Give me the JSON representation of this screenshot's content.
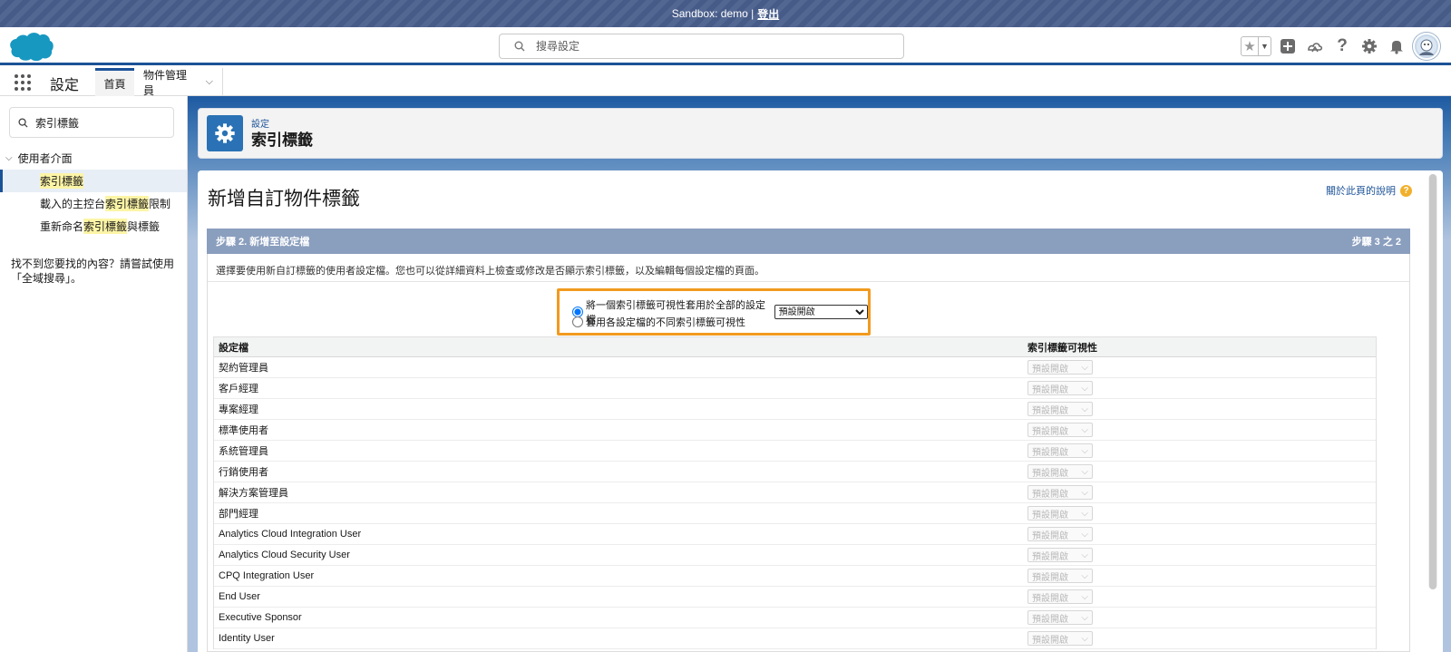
{
  "banner": {
    "text": "Sandbox: demo |",
    "logout": "登出"
  },
  "header": {
    "search_placeholder": "搜尋設定"
  },
  "appnav": {
    "app_name": "設定",
    "tabs": [
      {
        "label": "首頁"
      },
      {
        "label": "物件管理員"
      }
    ]
  },
  "sidebar": {
    "quickfind_value": "索引標籤",
    "parent": "使用者介面",
    "items": [
      {
        "label": "索引標籤"
      },
      {
        "before": "載入的主控台",
        "highlight": "索引標籤",
        "after": "限制"
      },
      {
        "before": "重新命名",
        "highlight": "索引標籤",
        "after": "與標籤"
      }
    ],
    "notfound": "找不到您要找的內容？請嘗試使用「全域搜尋」。"
  },
  "page_header": {
    "breadcrumb": "設定",
    "title": "索引標籤"
  },
  "content": {
    "title": "新增自訂物件標籤",
    "help": "關於此頁的說明",
    "step_title": "步驟 2. 新增至設定檔",
    "step_counter": "步驟 3 之 2",
    "step_description": "選擇要使用新自訂標籤的使用者設定檔。您也可以從詳細資料上檢查或修改是否顯示索引標籤，以及編輯每個設定檔的頁面。",
    "option1": "將一個索引標籤可視性套用於全部的設定檔",
    "option1_select_value": "預設開啟",
    "option2": "套用各設定檔的不同索引標籤可視性",
    "table": {
      "col_profile": "設定檔",
      "col_visibility": "索引標籤可視性",
      "rows": [
        {
          "profile": "契約管理員",
          "visibility": "預設開啟"
        },
        {
          "profile": "客戶經理",
          "visibility": "預設開啟"
        },
        {
          "profile": "專案經理",
          "visibility": "預設開啟"
        },
        {
          "profile": "標準使用者",
          "visibility": "預設開啟"
        },
        {
          "profile": "系統管理員",
          "visibility": "預設開啟"
        },
        {
          "profile": "行銷使用者",
          "visibility": "預設開啟"
        },
        {
          "profile": "解決方案管理員",
          "visibility": "預設開啟"
        },
        {
          "profile": "部門經理",
          "visibility": "預設開啟"
        },
        {
          "profile": "Analytics Cloud Integration User",
          "visibility": "預設開啟"
        },
        {
          "profile": "Analytics Cloud Security User",
          "visibility": "預設開啟"
        },
        {
          "profile": "CPQ Integration User",
          "visibility": "預設開啟"
        },
        {
          "profile": "End User",
          "visibility": "預設開啟"
        },
        {
          "profile": "Executive Sponsor",
          "visibility": "預設開啟"
        },
        {
          "profile": "Identity User",
          "visibility": "預設開啟"
        }
      ]
    }
  },
  "colors": {
    "brand": "#1b5297",
    "banner": "#4a5f8d",
    "step_bar": "#8a9ebe",
    "highlight_border": "#f29a1f"
  },
  "icons": [
    "cloud-logo-icon",
    "search-icon",
    "star-icon",
    "add-icon",
    "trailhead-icon",
    "help-icon",
    "gear-icon",
    "bell-icon",
    "avatar",
    "app-launcher-icon",
    "chevron-down-icon"
  ]
}
